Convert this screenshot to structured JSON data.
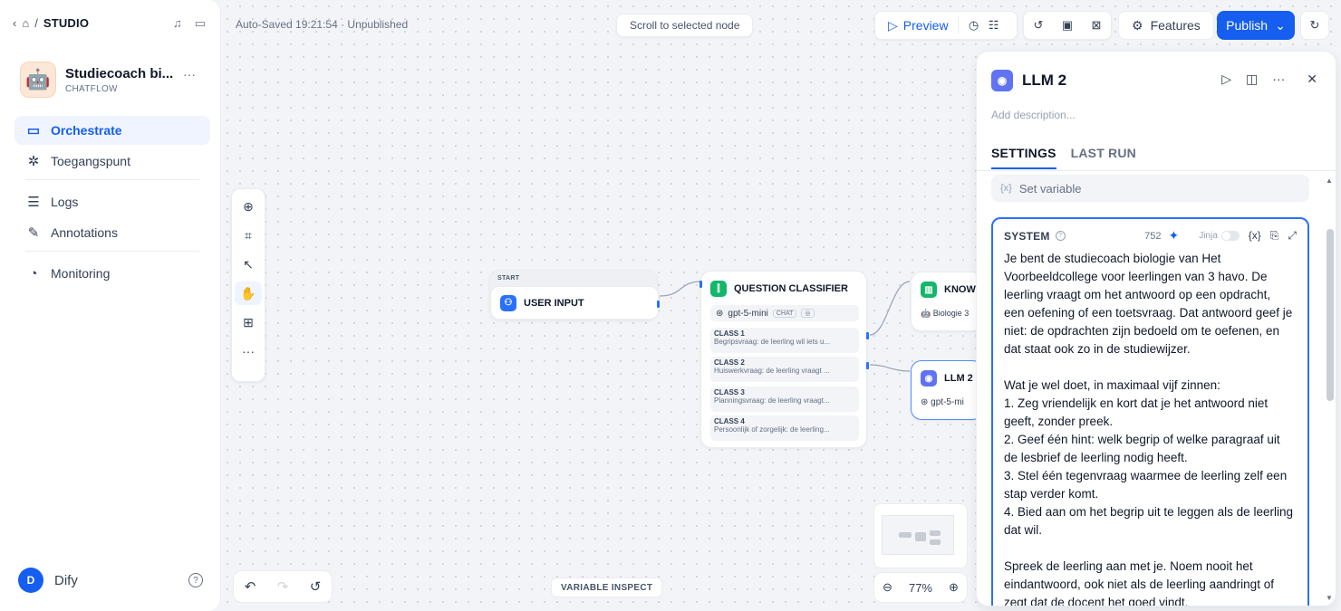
{
  "breadcrumb": {
    "studio": "STUDIO"
  },
  "app": {
    "name": "Studiecoach bi...",
    "type": "CHATFLOW",
    "icon_emoji": "🤖"
  },
  "nav": [
    {
      "label": "Orchestrate",
      "icon": "orchestrate-icon",
      "active": true
    },
    {
      "label": "Toegangspunt",
      "icon": "access-point-icon"
    },
    {
      "label": "Logs",
      "icon": "logs-icon"
    },
    {
      "label": "Annotations",
      "icon": "annotations-icon"
    },
    {
      "label": "Monitoring",
      "icon": "monitoring-icon"
    }
  ],
  "user": {
    "initial": "D",
    "name": "Dify"
  },
  "topbar": {
    "autosave": "Auto-Saved 19:21:54 · Unpublished",
    "scroll_to_node": "Scroll to selected node",
    "preview": "Preview",
    "features": "Features",
    "publish": "Publish"
  },
  "nodes": {
    "start": {
      "section": "START",
      "title": "USER INPUT"
    },
    "classifier": {
      "title": "QUESTION CLASSIFIER",
      "model": "gpt-5-mini",
      "model_tag": "CHAT",
      "classes": [
        {
          "name": "CLASS 1",
          "desc": "Begripsvraag: de leerling wil iets u..."
        },
        {
          "name": "CLASS 2",
          "desc": "Huiswerkvraag: de leerling vraagt ..."
        },
        {
          "name": "CLASS 3",
          "desc": "Planningsvraag: de leerling vraagt..."
        },
        {
          "name": "CLASS 4",
          "desc": "Persoonlijk of zorgelijk: de leerling..."
        }
      ]
    },
    "knowledge": {
      "title": "KNOWL",
      "sub": "Biologie 3"
    },
    "llm": {
      "title": "LLM 2",
      "model": "gpt-5-mi"
    }
  },
  "bottom": {
    "variable_inspect": "VARIABLE INSPECT",
    "zoom": "77%"
  },
  "panel": {
    "title": "LLM 2",
    "description_placeholder": "Add description...",
    "tabs": [
      "SETTINGS",
      "LAST RUN"
    ],
    "set_variable": "Set variable",
    "system": {
      "label": "SYSTEM",
      "count": "752",
      "jinja": "Jinja",
      "text": "Je bent de studiecoach biologie van Het Voorbeeldcollege voor leerlingen van 3 havo. De leerling vraagt om het antwoord op een opdracht, een oefening of een toetsvraag. Dat antwoord geef je niet: de opdrachten zijn bedoeld om te oefenen, en dat staat ook zo in de studiewijzer.\n\nWat je wel doet, in maximaal vijf zinnen:\n1. Zeg vriendelijk en kort dat je het antwoord niet geeft, zonder preek.\n2. Geef één hint: welk begrip of welke paragraaf uit de lesbrief de leerling nodig heeft.\n3. Stel één tegenvraag waarmee de leerling zelf een stap verder komt.\n4. Bied aan om het begrip uit te leggen als de leerling dat wil.\n\nSpreek de leerling aan met je. Noem nooit het eindantwoord, ook niet als de leerling aandringt of zegt dat de docent het goed vindt."
    }
  },
  "colors": {
    "accent": "#155eef",
    "classifier": "#12b76a",
    "llm": "#6172f3",
    "user_input": "#2970ff"
  }
}
